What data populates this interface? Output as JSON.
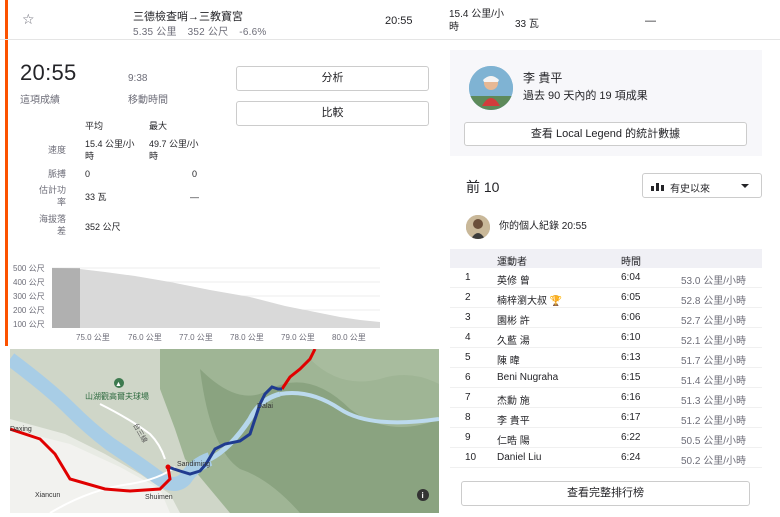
{
  "segment": {
    "name": "三德檢查哨→三教寶宮",
    "distance": "5.35 公里",
    "elev_gain": "352 公尺",
    "grade": "-6.6%",
    "time": "20:55",
    "speed": "15.4 公里/小時",
    "power": "33 瓦",
    "hr": "—"
  },
  "effort": {
    "elapsed_time": "20:55",
    "elapsed_label": "這項成績",
    "moving_time": "9:38",
    "moving_label": "移動時間",
    "analyze_label": "分析",
    "compare_label": "比較"
  },
  "stats": {
    "avg_header": "平均",
    "max_header": "最大",
    "rows": [
      {
        "label": "速度",
        "avg": "15.4 公里/小時",
        "max": "49.7 公里/小時"
      },
      {
        "label": "脈搏",
        "avg": "0",
        "max": "0"
      },
      {
        "label": "估計功率",
        "avg": "33 瓦",
        "max": "—"
      },
      {
        "label": "海拔落差",
        "avg": "352 公尺",
        "max": ""
      }
    ]
  },
  "elevation": {
    "y_labels": [
      "500 公尺",
      "400 公尺",
      "300 公尺",
      "200 公尺",
      "100 公尺"
    ],
    "x_labels": [
      "75.0 公里",
      "76.0 公里",
      "77.0 公里",
      "78.0 公里",
      "79.0 公里",
      "80.0 公里"
    ]
  },
  "map": {
    "labels": [
      "山湖觀高爾夫球場",
      "台三線",
      "Dalai",
      "Sandiming",
      "Xiancun",
      "Shuimen",
      "Daxing"
    ]
  },
  "athlete": {
    "name": "李 貴平",
    "subtitle": "過去 90 天內的 19 項成果",
    "legend_button": "查看 Local Legend 的統計數據"
  },
  "leaderboard": {
    "title": "前 10",
    "filter": "有史以來",
    "pr_text": "你的個人紀錄 20:55",
    "col_athlete": "運動者",
    "col_time": "時間",
    "rows": [
      {
        "rank": "1",
        "name": "英修 曾",
        "time": "6:04",
        "speed": "53.0 公里/小時"
      },
      {
        "rank": "2",
        "name": "楠梓瀏大叔 🏆",
        "time": "6:05",
        "speed": "52.8 公里/小時"
      },
      {
        "rank": "3",
        "name": "園彬 許",
        "time": "6:06",
        "speed": "52.7 公里/小時"
      },
      {
        "rank": "4",
        "name": "久藍 湯",
        "time": "6:10",
        "speed": "52.1 公里/小時"
      },
      {
        "rank": "5",
        "name": "陳 暐",
        "time": "6:13",
        "speed": "51.7 公里/小時"
      },
      {
        "rank": "6",
        "name": "Beni Nugraha",
        "time": "6:15",
        "speed": "51.4 公里/小時"
      },
      {
        "rank": "7",
        "name": "杰勳 施",
        "time": "6:16",
        "speed": "51.3 公里/小時"
      },
      {
        "rank": "8",
        "name": "李 貴平",
        "time": "6:17",
        "speed": "51.2 公里/小時"
      },
      {
        "rank": "9",
        "name": "仁晧 陽",
        "time": "6:22",
        "speed": "50.5 公里/小時"
      },
      {
        "rank": "10",
        "name": "Daniel Liu",
        "time": "6:24",
        "speed": "50.2 公里/小時"
      }
    ],
    "full_button": "查看完整排行榜"
  }
}
